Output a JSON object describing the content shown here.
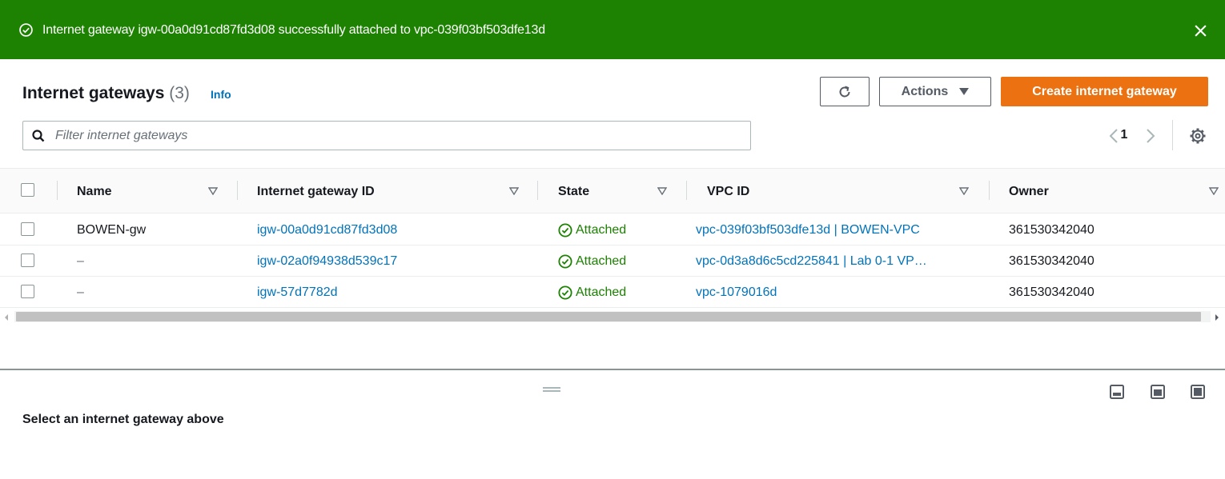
{
  "flash": {
    "message": "Internet gateway igw-00a0d91cd87fd3d08 successfully attached to vpc-039f03bf503dfe13d",
    "color": "#1d8102",
    "icons": {
      "status": "check-circle-icon",
      "dismiss": "close-icon"
    }
  },
  "header": {
    "title": "Internet gateways",
    "count": "(3)",
    "info": "Info"
  },
  "toolbar": {
    "refresh_icon": "refresh-icon",
    "actions_label": "Actions",
    "create_label": "Create internet gateway",
    "primary_color": "#ec7211"
  },
  "search": {
    "placeholder": "Filter internet gateways",
    "value": ""
  },
  "pagination": {
    "current_page": "1"
  },
  "table": {
    "columns": [
      "Name",
      "Internet gateway ID",
      "State",
      "VPC ID",
      "Owner"
    ],
    "rows": [
      {
        "name": "BOWEN-gw",
        "id": "igw-00a0d91cd87fd3d08",
        "state": "Attached",
        "vpc": "vpc-039f03bf503dfe13d | BOWEN-VPC",
        "owner": "361530342040"
      },
      {
        "name": "–",
        "id": "igw-02a0f94938d539c17",
        "state": "Attached",
        "vpc": "vpc-0d3a8d6c5cd225841 | Lab 0-1 VP…",
        "owner": "361530342040"
      },
      {
        "name": "–",
        "id": "igw-57d7782d",
        "state": "Attached",
        "vpc": "vpc-1079016d",
        "owner": "361530342040"
      }
    ],
    "link_color": "#0073bb",
    "success_color": "#1d8102"
  },
  "split_panel": {
    "empty_message": "Select an internet gateway above"
  }
}
